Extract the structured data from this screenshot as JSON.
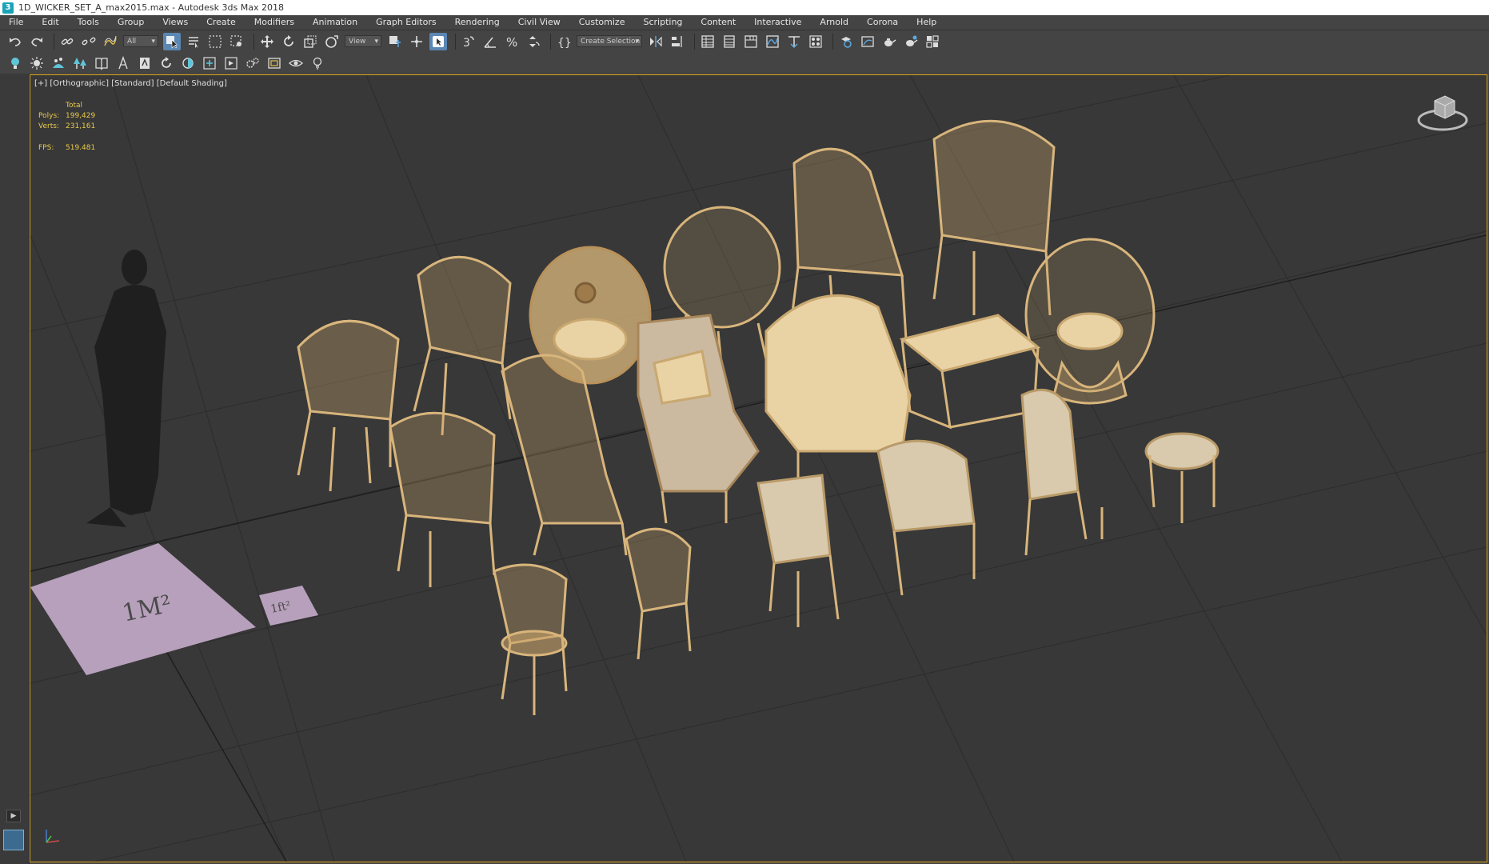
{
  "window": {
    "title": "1D_WICKER_SET_A_max2015.max - Autodesk 3ds Max 2018",
    "app_badge": "3"
  },
  "menu": [
    "File",
    "Edit",
    "Tools",
    "Group",
    "Views",
    "Create",
    "Modifiers",
    "Animation",
    "Graph Editors",
    "Rendering",
    "Civil View",
    "Customize",
    "Scripting",
    "Content",
    "Interactive",
    "Arnold",
    "Corona",
    "Help"
  ],
  "toolbar": {
    "selection_filter": "All",
    "ref_coord": "View",
    "named_selection": "Create Selection Se",
    "snap_angle": "3",
    "percent_snap": "%"
  },
  "viewport": {
    "label": "[+] [Orthographic] [Standard] [Default Shading]",
    "stats": {
      "header": "Total",
      "polys_label": "Polys:",
      "polys": "199,429",
      "verts_label": "Verts:",
      "verts": "231,161",
      "fps_label": "FPS:",
      "fps": "519.481"
    },
    "plaque_large": "1M²",
    "plaque_small": "1ft²"
  },
  "timeline": {
    "play_glyph": "▶"
  },
  "colors": {
    "accent_active": "#5b87b3",
    "viewport_border": "#d7a51a",
    "stats_text": "#e8c94a",
    "wicker": "#d8b57c",
    "cushion": "#e9d3a5",
    "plaque": "#b7a0bc"
  }
}
